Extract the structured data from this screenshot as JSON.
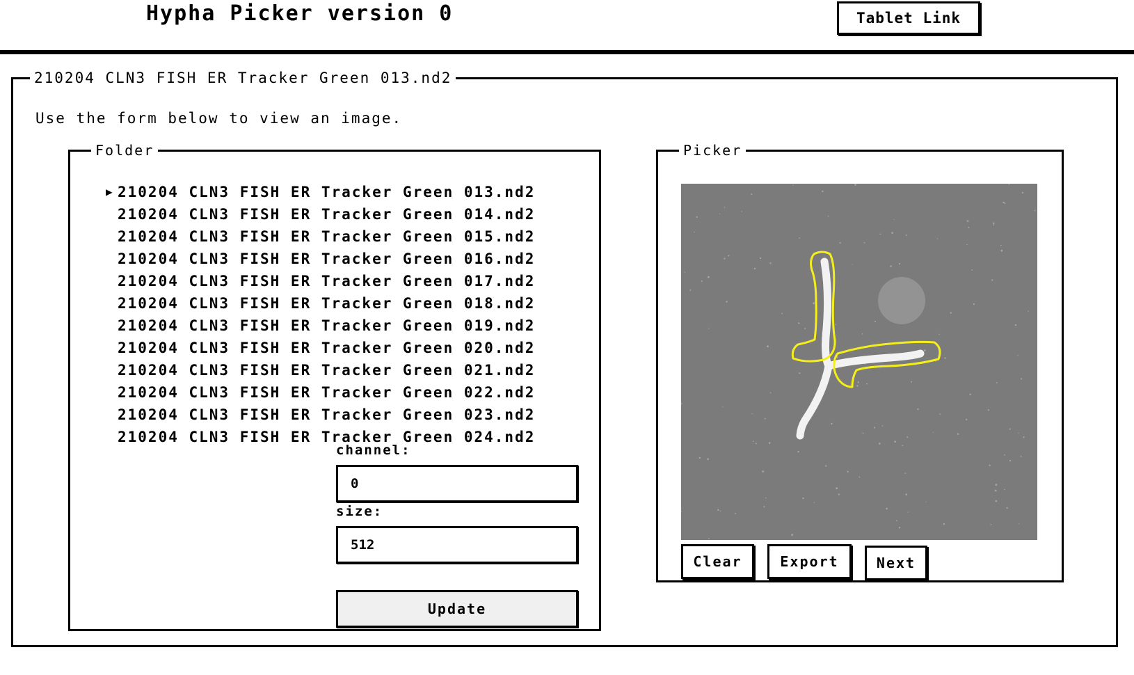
{
  "header": {
    "title": "Hypha Picker version 0",
    "tablet_link_label": "Tablet Link"
  },
  "main": {
    "legend": "210204 CLN3 FISH ER Tracker Green 013.nd2",
    "instruction": "Use the form below to view an image."
  },
  "folder": {
    "legend": "Folder",
    "selected_index": 0,
    "selected_marker": "▶",
    "files": [
      "210204 CLN3 FISH ER Tracker Green 013.nd2",
      "210204 CLN3 FISH ER Tracker Green 014.nd2",
      "210204 CLN3 FISH ER Tracker Green 015.nd2",
      "210204 CLN3 FISH ER Tracker Green 016.nd2",
      "210204 CLN3 FISH ER Tracker Green 017.nd2",
      "210204 CLN3 FISH ER Tracker Green 018.nd2",
      "210204 CLN3 FISH ER Tracker Green 019.nd2",
      "210204 CLN3 FISH ER Tracker Green 020.nd2",
      "210204 CLN3 FISH ER Tracker Green 021.nd2",
      "210204 CLN3 FISH ER Tracker Green 022.nd2",
      "210204 CLN3 FISH ER Tracker Green 023.nd2",
      "210204 CLN3 FISH ER Tracker Green 024.nd2"
    ],
    "channel_label": "channel:",
    "channel_value": "0",
    "size_label": "size:",
    "size_value": "512",
    "update_label": "Update"
  },
  "picker": {
    "legend": "Picker",
    "clear_label": "Clear",
    "export_label": "Export",
    "next_label": "Next",
    "image_background": "#7b7b7b",
    "outline_color": "#f4ee1a",
    "signal_color": "#f2f2f2"
  }
}
